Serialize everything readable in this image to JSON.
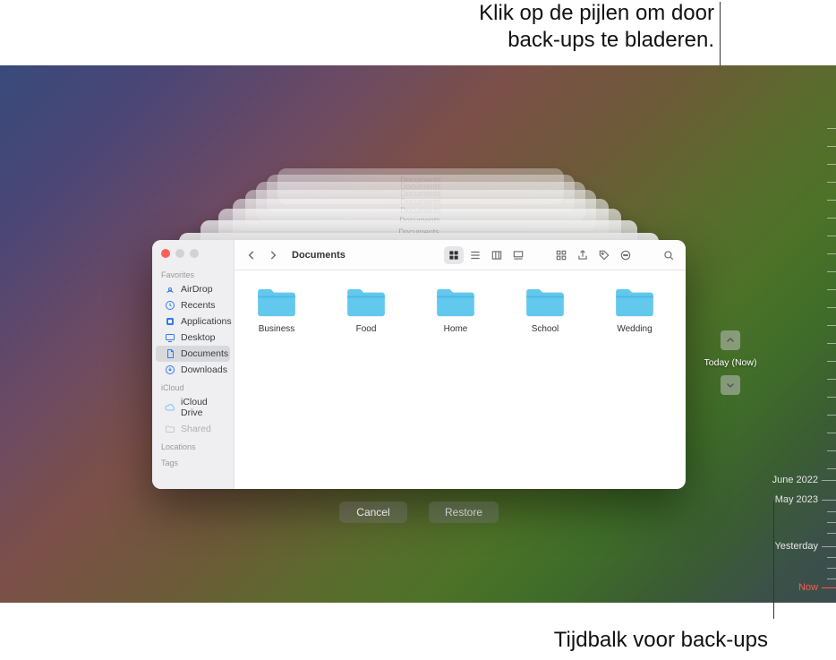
{
  "callouts": {
    "top_line1": "Klik op de pijlen om door",
    "top_line2": "back-ups te bladeren.",
    "bottom": "Tijdbalk voor back-ups"
  },
  "window": {
    "title": "Documents",
    "sidebar": {
      "favorites_header": "Favorites",
      "icloud_header": "iCloud",
      "locations_header": "Locations",
      "tags_header": "Tags",
      "items": {
        "airdrop": "AirDrop",
        "recents": "Recents",
        "applications": "Applications",
        "desktop": "Desktop",
        "documents": "Documents",
        "downloads": "Downloads",
        "icloud_drive": "iCloud Drive",
        "shared": "Shared"
      }
    },
    "folders": [
      "Business",
      "Food",
      "Home",
      "School",
      "Wedding"
    ]
  },
  "nav": {
    "now_label": "Today (Now)"
  },
  "buttons": {
    "cancel": "Cancel",
    "restore": "Restore"
  },
  "timeline": {
    "labels": [
      "June 2022",
      "May 2023",
      "Yesterday",
      "Now"
    ]
  }
}
